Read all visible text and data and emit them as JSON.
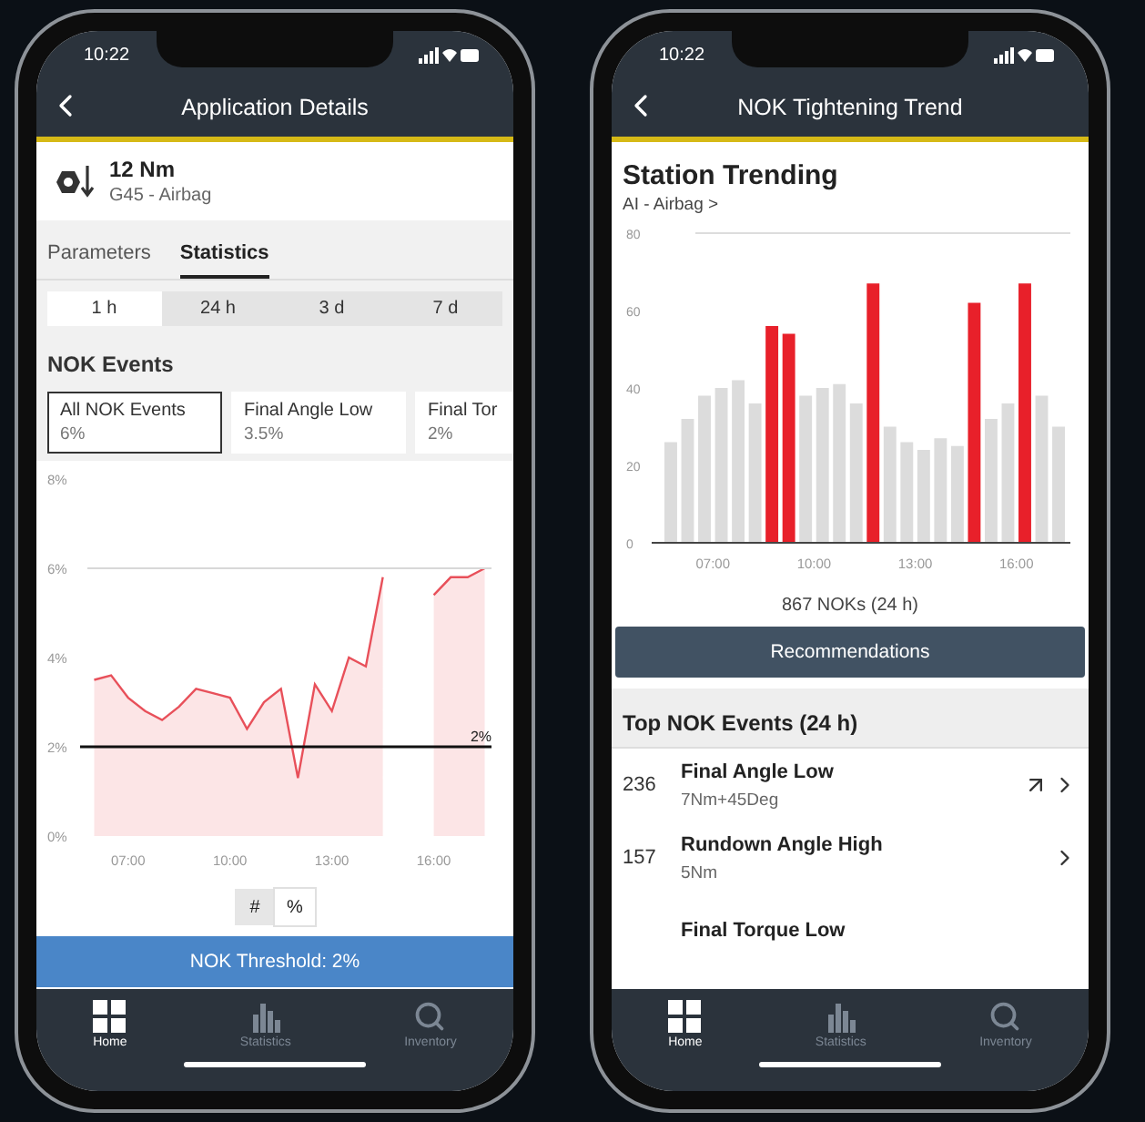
{
  "phones": [
    {
      "kind": "details",
      "time": "10:22",
      "title": "Application Details",
      "header": {
        "value": "12 Nm",
        "subtitle": "G45 - Airbag"
      },
      "tabs": [
        {
          "label": "Parameters",
          "selected": false
        },
        {
          "label": "Statistics",
          "selected": true
        }
      ],
      "ranges": [
        {
          "label": "1 h",
          "selected": true
        },
        {
          "label": "24 h",
          "selected": false
        },
        {
          "label": "3 d",
          "selected": false
        },
        {
          "label": "7 d",
          "selected": false
        }
      ],
      "section_title": "NOK Events",
      "event_cards": [
        {
          "label": "All NOK Events",
          "value": "6%",
          "selected": true
        },
        {
          "label": "Final Angle Low",
          "value": "3.5%",
          "selected": false
        },
        {
          "label": "Final Tor",
          "value": "2%",
          "selected": false
        }
      ],
      "chart_data": {
        "type": "area",
        "x": [
          6,
          6.5,
          7,
          7.5,
          8,
          8.5,
          9,
          9.5,
          10,
          10.5,
          11,
          11.5,
          12,
          12.5,
          13,
          13.5,
          14,
          14.5,
          15,
          15.5,
          16,
          16.5,
          17,
          17.5
        ],
        "series": [
          {
            "color": "#e8505a",
            "values": [
              3.5,
              3.6,
              3.1,
              2.8,
              2.6,
              2.9,
              3.3,
              3.2,
              3.1,
              2.4,
              3.0,
              3.3,
              1.3,
              3.4,
              2.8,
              4.0,
              3.8,
              5.8,
              null,
              null,
              5.4,
              5.8,
              5.8,
              6.0
            ]
          }
        ],
        "xlim": [
          5.8,
          17.7
        ],
        "ylim": [
          0,
          8
        ],
        "xticks": [
          {
            "value": 7,
            "label": "07:00"
          },
          {
            "value": 10,
            "label": "10:00"
          },
          {
            "value": 13,
            "label": "13:00"
          },
          {
            "value": 16,
            "label": "16:00"
          }
        ],
        "yticks": [
          {
            "value": 0,
            "label": "0%"
          },
          {
            "value": 2,
            "label": "2%"
          },
          {
            "value": 4,
            "label": "4%"
          },
          {
            "value": 6,
            "label": "6%"
          },
          {
            "value": 8,
            "label": "8%"
          }
        ],
        "ref_lines": [
          {
            "axis": "y",
            "value": 6
          },
          {
            "axis": "y",
            "value": 2,
            "label": "2%"
          }
        ]
      },
      "units": [
        {
          "label": "#",
          "selected": false
        },
        {
          "label": "%",
          "selected": true
        }
      ],
      "threshold_button": "NOK Threshold: 2%",
      "nav": [
        {
          "label": "Home",
          "selected": true
        },
        {
          "label": "Statistics",
          "selected": false
        },
        {
          "label": "Inventory",
          "selected": false
        }
      ]
    },
    {
      "kind": "trend",
      "time": "10:22",
      "title": "NOK Tightening Trend",
      "heading": "Station Trending",
      "link": "AI - Airbag >",
      "chart_data": {
        "type": "bar",
        "x": [
          5.75,
          6.25,
          6.75,
          7.25,
          7.75,
          8.25,
          8.75,
          9.25,
          9.75,
          10.25,
          10.75,
          11.25,
          11.75,
          12.25,
          12.75,
          13.25,
          13.75,
          14.25,
          14.75,
          15.25,
          15.75,
          16.25,
          16.75,
          17.25
        ],
        "series": [
          {
            "color": "#dcdcdc",
            "values": [
              26,
              32,
              38,
              40,
              42,
              36,
              null,
              null,
              38,
              40,
              41,
              36,
              null,
              30,
              26,
              24,
              27,
              25,
              null,
              32,
              36,
              null,
              38,
              30
            ]
          },
          {
            "color": "#e8202a",
            "values": [
              null,
              null,
              null,
              null,
              null,
              null,
              56,
              54,
              null,
              null,
              null,
              null,
              67,
              null,
              null,
              null,
              null,
              null,
              62,
              null,
              null,
              67,
              null,
              null
            ]
          }
        ],
        "xlim": [
          5.4,
          17.6
        ],
        "ylim": [
          0,
          80
        ],
        "xticks": [
          {
            "value": 7,
            "label": "07:00"
          },
          {
            "value": 10,
            "label": "10:00"
          },
          {
            "value": 13,
            "label": "13:00"
          },
          {
            "value": 16,
            "label": "16:00"
          }
        ],
        "yticks": [
          0,
          20,
          40,
          60,
          80
        ]
      },
      "summary": "867 NOKs (24 h)",
      "button": "Recommendations",
      "list_title": "Top NOK Events (24 h)",
      "events": [
        {
          "count": "236",
          "title": "Final Angle Low",
          "detail": "7Nm+45Deg",
          "trending": true
        },
        {
          "count": "157",
          "title": "Rundown Angle High",
          "detail": "5Nm",
          "trending": false
        },
        {
          "title": "Final Torque Low"
        }
      ],
      "nav": [
        {
          "label": "Home",
          "selected": true
        },
        {
          "label": "Statistics",
          "selected": false
        },
        {
          "label": "Inventory",
          "selected": false
        }
      ]
    }
  ]
}
